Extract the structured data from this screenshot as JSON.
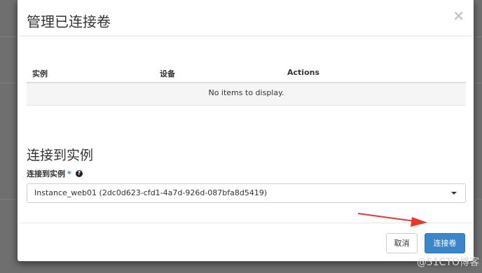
{
  "modal": {
    "title": "管理已连接卷",
    "close_label": "×"
  },
  "table": {
    "columns": [
      "实例",
      "设备",
      "Actions"
    ],
    "empty_message": "No items to display."
  },
  "attach": {
    "section_title": "连接到实例",
    "field_label": "连接到实例",
    "required_mark": "*",
    "help_glyph": "?",
    "selected_value": "Instance_web01 (2dc0d623-cfd1-4a7d-926d-087bfa8d5419)"
  },
  "footer": {
    "cancel_label": "取消",
    "submit_label": "连接卷"
  },
  "annotation": {
    "arrow_color": "#e8392b"
  },
  "watermark": "@51CTO博客",
  "colors": {
    "primary": "#3b86c8",
    "overlay": "#6f6f6f"
  }
}
